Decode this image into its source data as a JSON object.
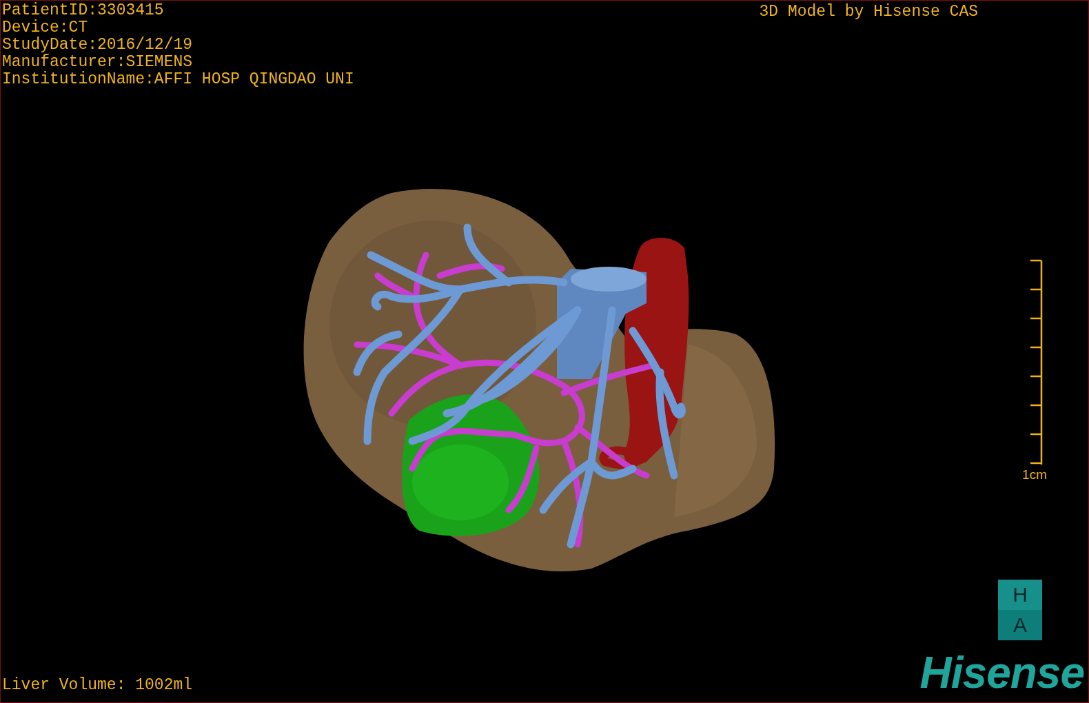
{
  "overlay": {
    "patient_info": [
      "PatientID:3303415",
      "Device:CT",
      "StudyDate:2016/12/19",
      "Manufacturer:SIEMENS",
      "InstitutionName:AFFI HOSP QINGDAO UNI"
    ],
    "title": "3D Model by Hisense CAS",
    "liver_volume": "Liver Volume: 1002ml"
  },
  "scale_bar": {
    "label": "1cm"
  },
  "orientation_cube": {
    "top": "H",
    "bottom": "A"
  },
  "logo": "Hisense"
}
